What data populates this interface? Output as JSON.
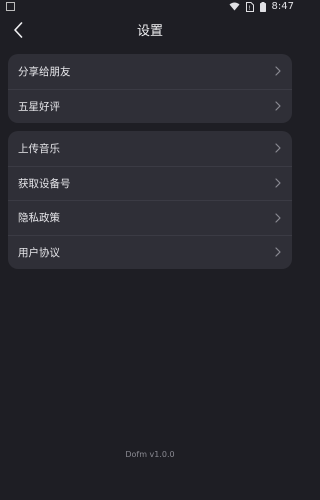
{
  "status_bar": {
    "time": "8:47"
  },
  "header": {
    "title": "设置",
    "back_icon": "chevron-left-icon"
  },
  "groups": [
    {
      "items": [
        {
          "label": "分享给朋友"
        },
        {
          "label": "五星好评"
        }
      ]
    },
    {
      "items": [
        {
          "label": "上传音乐"
        },
        {
          "label": "获取设备号"
        },
        {
          "label": "隐私政策"
        },
        {
          "label": "用户协议"
        }
      ]
    }
  ],
  "footer": {
    "version": "Dofm v1.0.0"
  },
  "colors": {
    "background": "#1e1e24",
    "card": "#2f2f37",
    "divider": "#3b3b44",
    "text": "#e6e6ea",
    "muted": "#8a8a92"
  }
}
